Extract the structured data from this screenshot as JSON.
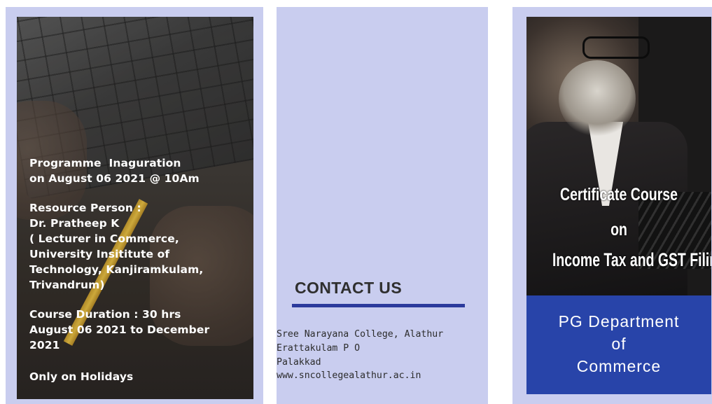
{
  "left_card": {
    "inauguration": "Programme  Inaguration\non August 06 2021 @ 10Am",
    "resource": "Resource Person :\nDr. Pratheep K\n( Lecturer in Commerce,\nUniversity Insititute of\nTechnology, Kanjiramkulam,\nTrivandrum)",
    "duration": "Course Duration : 30 hrs\nAugust 06 2021 to December\n2021",
    "holidays": "Only on Holidays"
  },
  "middle_card": {
    "heading": "CONTACT US",
    "address": [
      "Sree Narayana College, Alathur",
      "Erattakulam P O",
      "Palakkad",
      "www.sncollegealathur.ac.in"
    ]
  },
  "right_card": {
    "title_lines": [
      "Certificate Course",
      "on",
      "Income Tax and GST Filing"
    ],
    "department_lines": [
      "PG Department",
      "of",
      "Commerce"
    ]
  },
  "colors": {
    "panel_bg": "#c9cdef",
    "accent_blue": "#2844a9",
    "underline": "#2b3a9c"
  }
}
